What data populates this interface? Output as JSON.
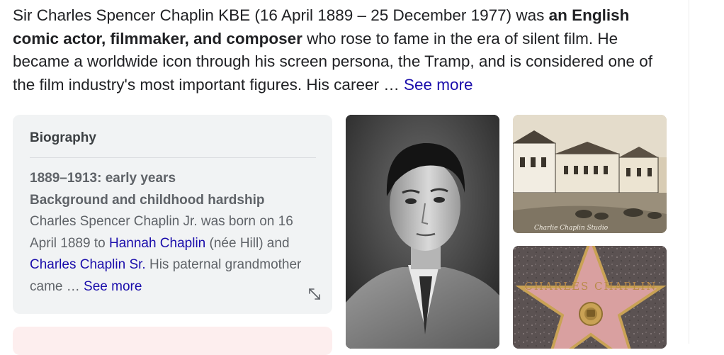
{
  "intro": {
    "text_before": "Sir Charles Spencer Chaplin KBE (16 April 1889 – 25 December 1977) was ",
    "bold": "an English comic actor, filmmaker, and composer",
    "text_after": " who rose to fame in the era of silent film. He became a worldwide icon through his screen persona, the Tramp, and is considered one of the film industry's most important figures. His career … ",
    "see_more": "See more"
  },
  "biography": {
    "title": "Biography",
    "period": "1889–1913: early years",
    "subheading": "Background and childhood hardship",
    "text_1": "Charles Spencer Chaplin Jr. was born on 16 April 1889 to ",
    "link_mother": "Hannah Chaplin",
    "text_2": " (née Hill) and ",
    "link_father": "Charles Chaplin Sr.",
    "text_3": " His paternal grandmother came … ",
    "see_more": "See more",
    "expand_icon": "expand-diagonal-arrows-icon"
  },
  "images": {
    "studio_caption": "Charlie Chaplin Studio",
    "star_name": "CHARLES CHAPLIN",
    "colors": {
      "star_pink": "#d9a0a0",
      "star_gold": "#c9a255",
      "terrazzo": "#5b5252"
    }
  },
  "colors": {
    "link": "#1a0dab",
    "card_background": "#f1f3f4",
    "text_main": "#202124",
    "text_muted": "#5f6368"
  }
}
